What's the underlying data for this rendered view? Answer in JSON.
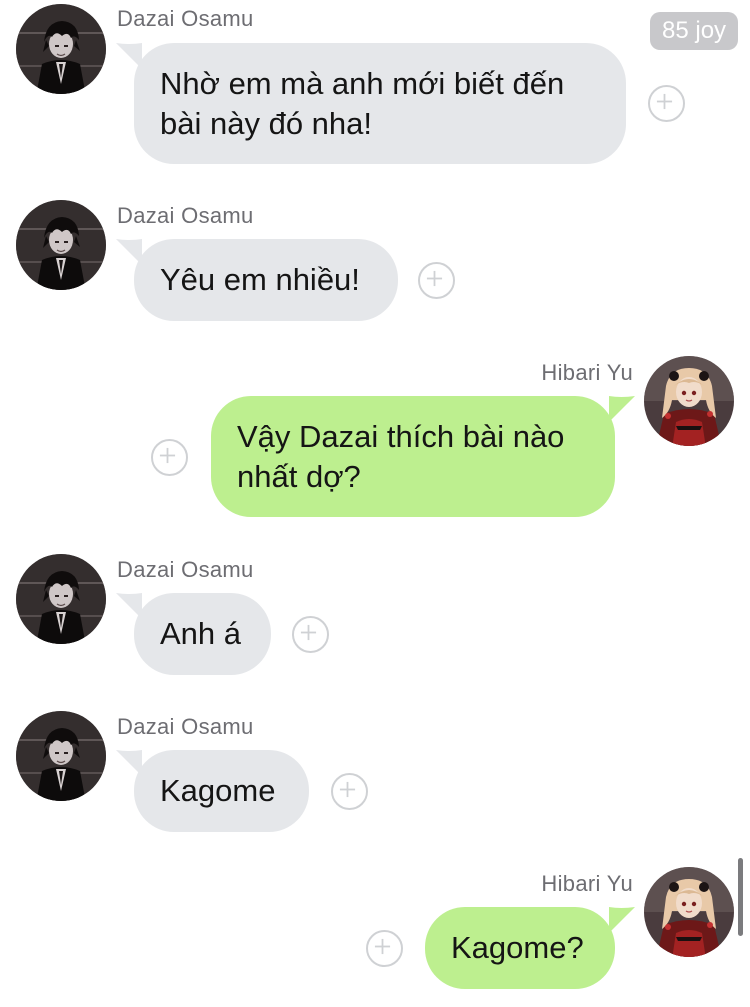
{
  "status": {
    "badge_text": "85 joy"
  },
  "contacts": {
    "dazai": {
      "name": "Dazai Osamu"
    },
    "hibari": {
      "name": "Hibari Yu"
    }
  },
  "messages": [
    {
      "sender": "Dazai Osamu",
      "direction": "incoming",
      "lines": [
        "Nhờ em mà anh mới biết đến",
        "bài này đó nha!"
      ]
    },
    {
      "sender": "Dazai Osamu",
      "direction": "incoming",
      "lines": [
        "Yêu em nhiều!"
      ]
    },
    {
      "sender": "Hibari Yu",
      "direction": "outgoing",
      "lines": [
        "Vậy Dazai thích bài nào",
        "nhất dợ?"
      ]
    },
    {
      "sender": "Dazai Osamu",
      "direction": "incoming",
      "lines": [
        "Anh á"
      ]
    },
    {
      "sender": "Dazai Osamu",
      "direction": "incoming",
      "lines": [
        "Kagome"
      ]
    },
    {
      "sender": "Hibari Yu",
      "direction": "outgoing",
      "lines": [
        "Kagome?"
      ]
    }
  ],
  "icons": {
    "reaction": "plus-circle-icon",
    "avatar_dazai": "avatar-dark-portrait",
    "avatar_hibari": "avatar-red-dress-portrait"
  },
  "colors": {
    "incoming_bubble": "#e5e7ea",
    "outgoing_bubble": "#bdef8f",
    "sender_text": "#6d6d72",
    "badge_bg": "#c8c8cb"
  }
}
